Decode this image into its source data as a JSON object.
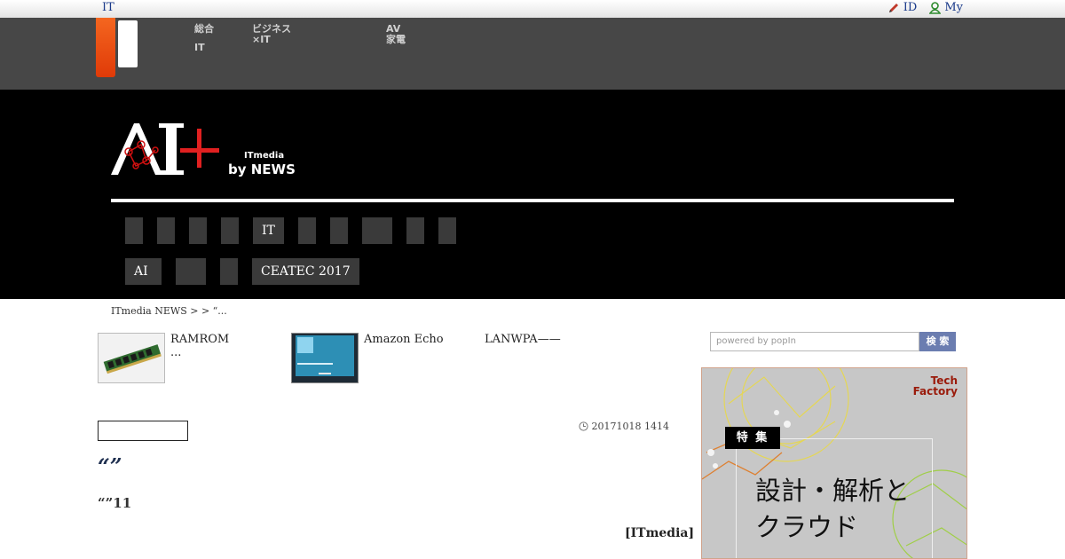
{
  "topbar": {
    "left": "IT",
    "id_label": "ID",
    "my_label": "My"
  },
  "gnav": [
    {
      "l1": "総合",
      "l2": "IT"
    },
    {
      "l1": "ビジネス",
      "l2": "×IT"
    },
    {
      "l1": "AV",
      "l2": "家電"
    }
  ],
  "brand": {
    "logo": "AI+",
    "sub_brand": "ITmedia",
    "sub_name": "by NEWS"
  },
  "categories_row1": [
    "",
    "",
    "",
    "",
    "IT",
    "",
    "",
    "",
    "",
    ""
  ],
  "categories_row2": [
    "AI",
    "",
    "",
    "CEATEC 2017"
  ],
  "breadcrumb": "ITmedia NEWS >  > “...",
  "related": [
    {
      "title_l1": "RAMROM",
      "title_l2": "..."
    },
    {
      "title_l1": "Amazon Echo",
      "title_l2": ""
    },
    {
      "title_l1": "LANWPA——",
      "title_l2": ""
    }
  ],
  "article": {
    "date": "20171018 1414",
    "title": "“”",
    "lead": "“”11",
    "source": "[ITmedia]"
  },
  "search": {
    "placeholder": "powered by popIn",
    "button": "検 索"
  },
  "ad": {
    "badge": "特 集",
    "line1": "設計・解析と",
    "line2": "クラウド",
    "brand_l1": "Tech",
    "brand_l2": "Factory"
  },
  "colors": {
    "accent": "#e03a08",
    "nav_bg": "#474747",
    "header_bg": "#000000",
    "button": "#6b7db0"
  }
}
